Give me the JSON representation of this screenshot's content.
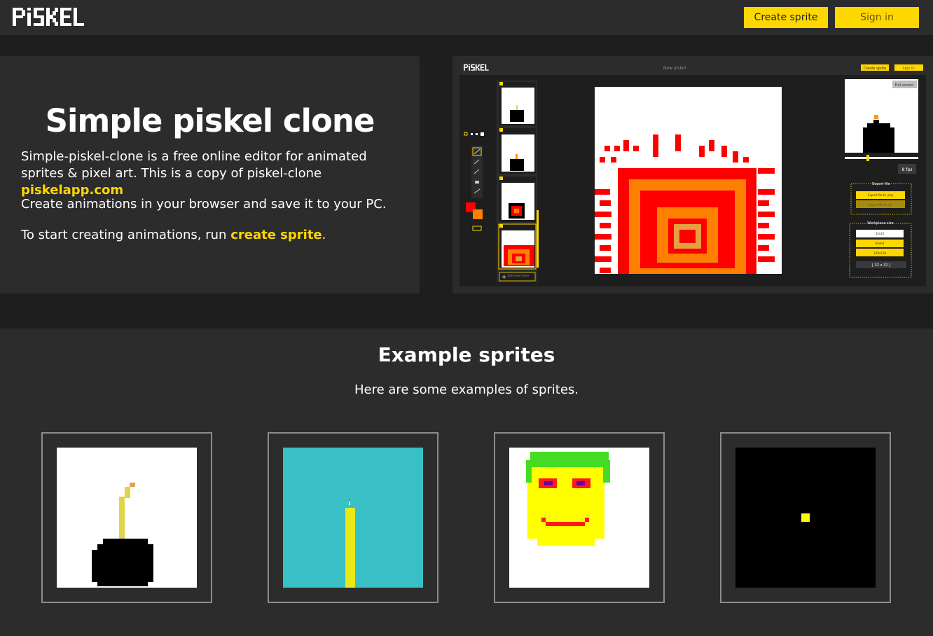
{
  "header": {
    "logo_text": "PiSKEL",
    "create_sprite_label": "Create sprite",
    "sign_in_label": "Sign in"
  },
  "hero": {
    "title": "Simple piskel clone",
    "p1_text": "Simple-piskel-clone is a free online editor for animated sprites & pixel art. This is a copy of piskel-clone ",
    "p1_link": "piskelapp.com",
    "p2_text": "Create animations in your browser and save it to your PC.",
    "p3_text": "To start creating animations, run ",
    "p3_link": "create sprite",
    "p3_end": "."
  },
  "preview": {
    "logo_text": "PiSKEL",
    "title": "New piskel",
    "create_sprite_label": "Create sprite",
    "sign_in_label": "Sign in",
    "fullscreen_label": "Full screen",
    "fps_label": "8 fps",
    "frame_numbers": [
      "1",
      "2",
      "3",
      "4"
    ],
    "add_frame_label": "Add new frame",
    "export_title": "Export file",
    "export_png": "Export file to .png",
    "export_gif": "Export file to .gif",
    "workspace_title": "Workplace size",
    "size_options": [
      "32x32",
      "64x64",
      "128x128"
    ],
    "current_size": "[ 32 x 32 ]"
  },
  "examples": {
    "title": "Example sprites",
    "subtitle": "Here are some examples of sprites.",
    "sprites": [
      {
        "icon": "bomb-icon",
        "background": "#ffffff"
      },
      {
        "icon": "candle-icon",
        "background": "#39bfc6"
      },
      {
        "icon": "smiley-face-icon",
        "background": "#ffffff"
      },
      {
        "icon": "yellow-dot-icon",
        "background": "#000000"
      }
    ]
  },
  "colors": {
    "accent": "#ffd700",
    "page_bg": "#1e1e1e",
    "card_bg": "#2c2c2c",
    "primary_color": "#ff0000",
    "secondary_color": "#ff8000"
  }
}
